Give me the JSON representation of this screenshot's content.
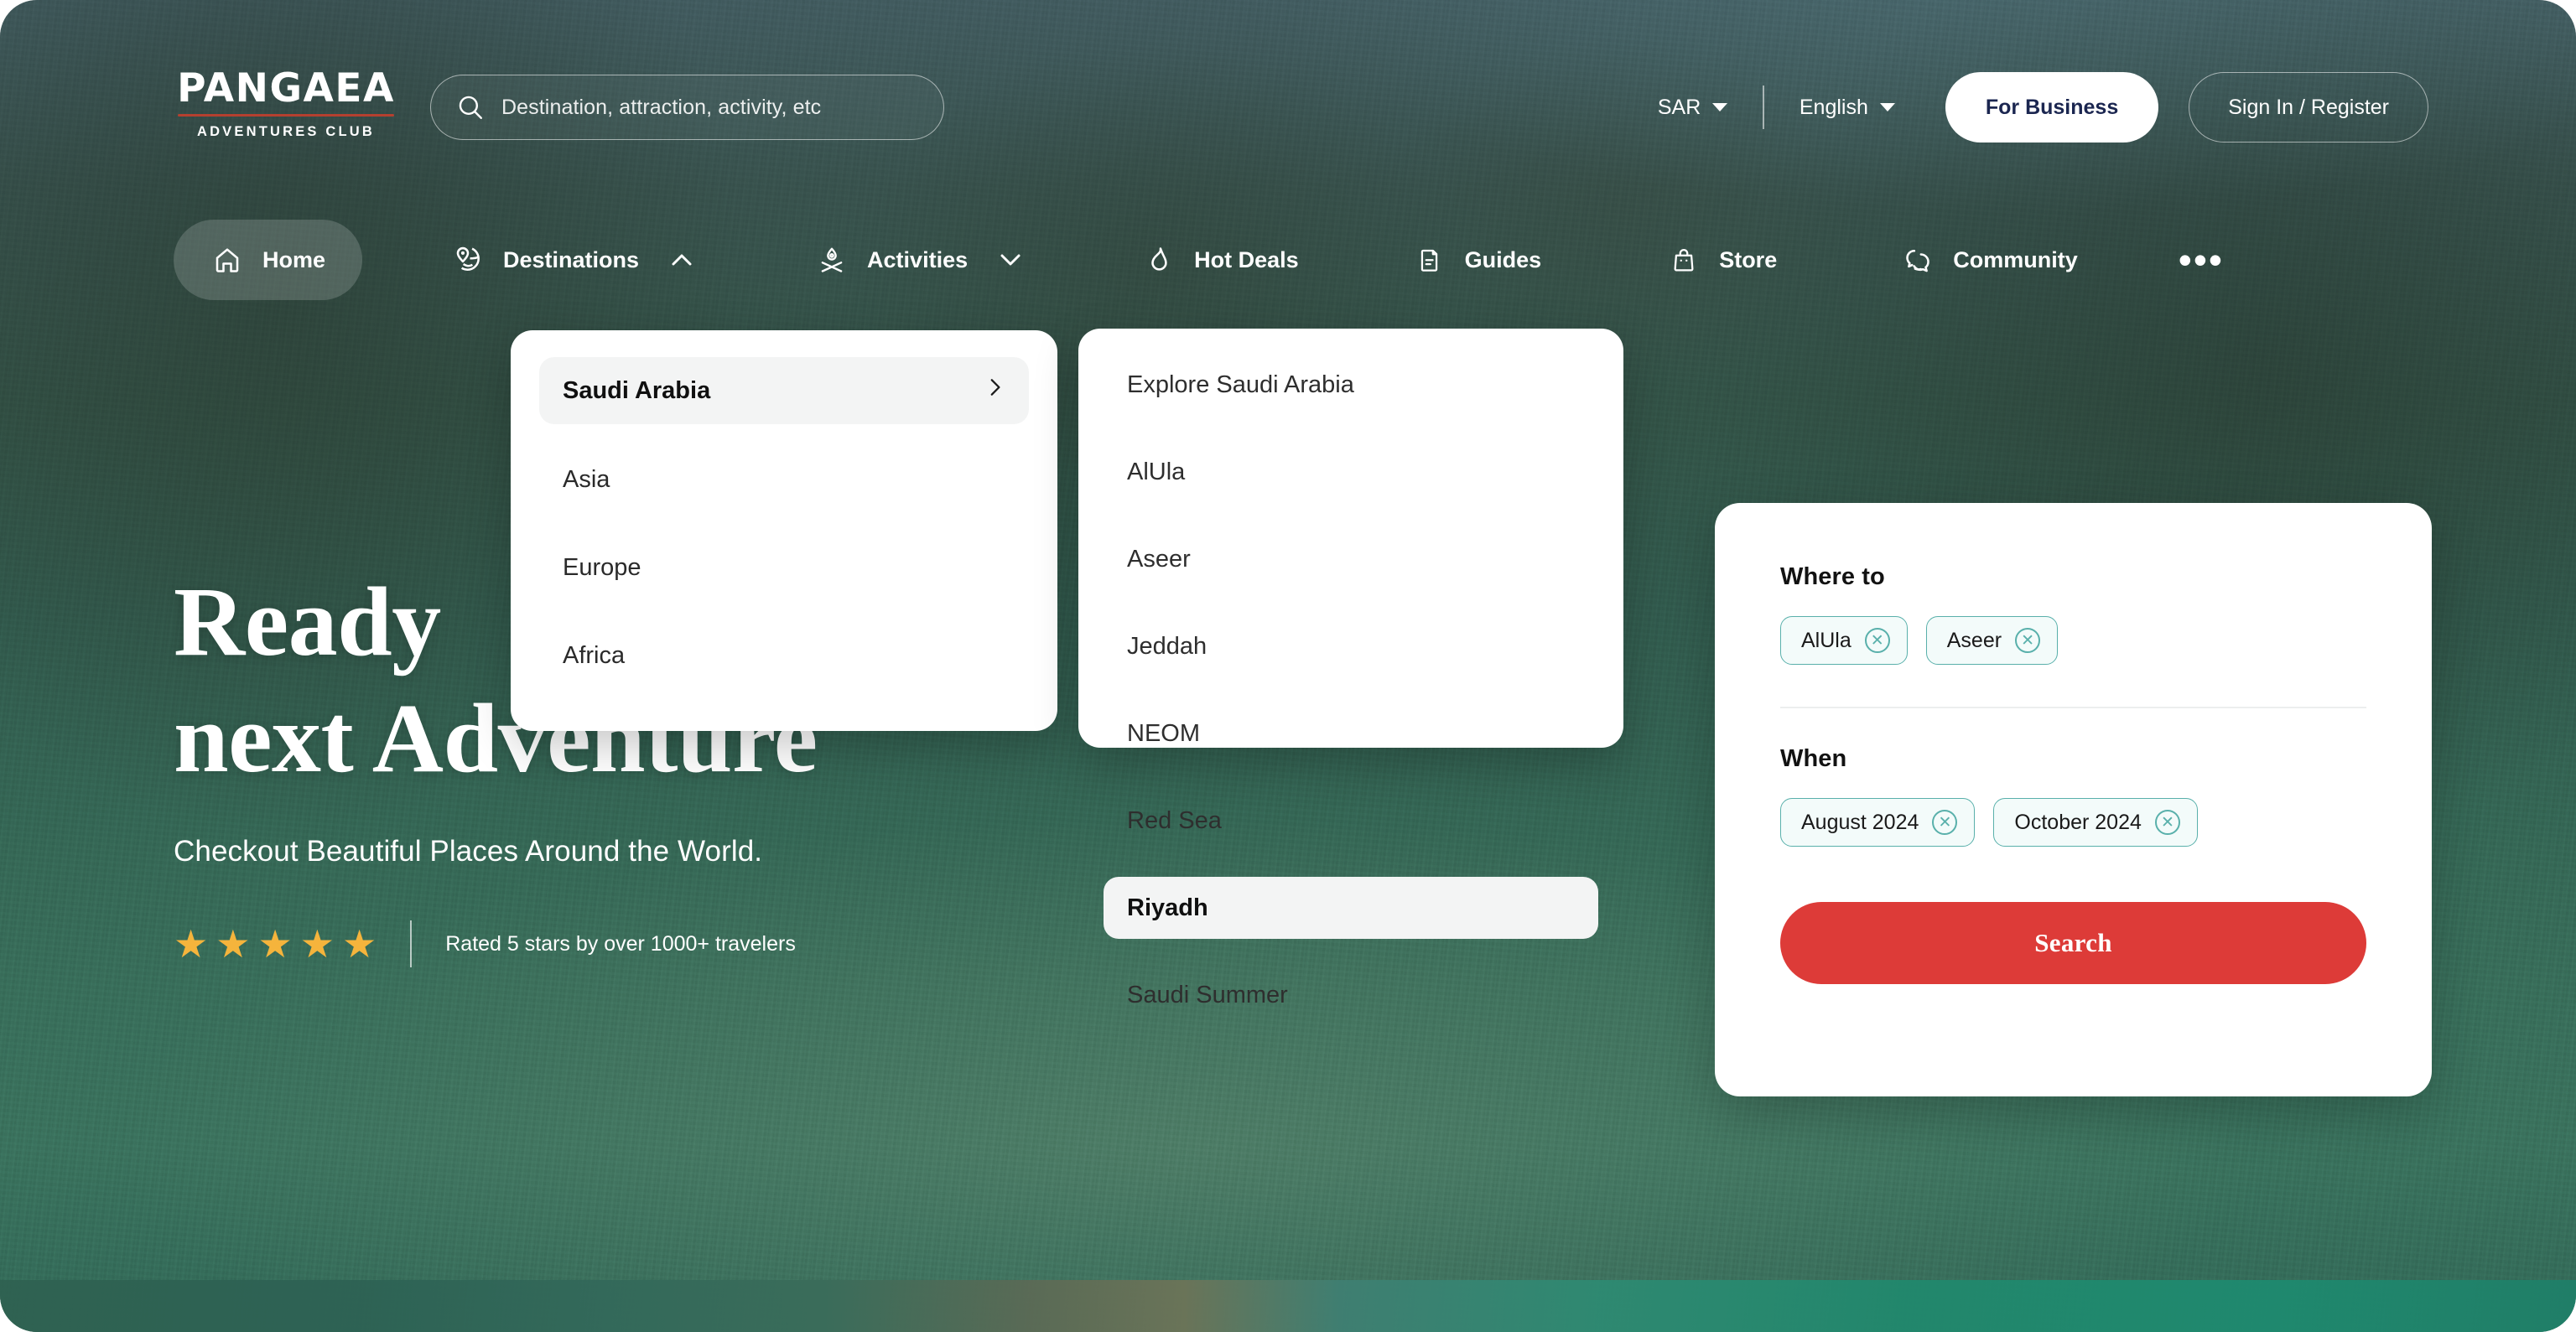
{
  "brand": {
    "name": "PANGAEA",
    "tagline": "ADVENTURES CLUB",
    "rule_color": "#b5402f"
  },
  "search_bar": {
    "placeholder": "Destination, attraction, activity, etc",
    "value": "",
    "icon": "search-icon"
  },
  "header": {
    "currency": "SAR",
    "language": "English",
    "for_business_label": "For Business",
    "sign_in_label": "Sign In / Register"
  },
  "nav": {
    "items": [
      {
        "label": "Home",
        "icon": "home-icon",
        "active": true,
        "caret": ""
      },
      {
        "label": "Destinations",
        "icon": "map-pin-globe-icon",
        "active": false,
        "caret": "chevron-up-icon"
      },
      {
        "label": "Activities",
        "icon": "campfire-icon",
        "active": false,
        "caret": "chevron-down-icon"
      },
      {
        "label": "Hot Deals",
        "icon": "flame-icon",
        "active": false,
        "caret": ""
      },
      {
        "label": "Guides",
        "icon": "guidebook-icon",
        "active": false,
        "caret": ""
      },
      {
        "label": "Store",
        "icon": "shopping-bag-icon",
        "active": false,
        "caret": ""
      },
      {
        "label": "Community",
        "icon": "chat-people-icon",
        "active": false,
        "caret": ""
      }
    ],
    "more_label": "•••"
  },
  "hero": {
    "title_line1": "Ready",
    "title_line2": "next Adventure",
    "subtitle": "Checkout Beautiful Places Around the World.",
    "rating_stars": 5,
    "rating_text": "Rated 5 stars by over 1000+ travelers",
    "star_color": "#f5b43c"
  },
  "regions_menu": {
    "items": [
      {
        "label": "Saudi Arabia",
        "selected": true,
        "chevron": "chevron-right-icon"
      },
      {
        "label": "Asia",
        "selected": false,
        "chevron": ""
      },
      {
        "label": "Europe",
        "selected": false,
        "chevron": ""
      },
      {
        "label": "Africa",
        "selected": false,
        "chevron": ""
      }
    ]
  },
  "destinations_menu": {
    "items": [
      {
        "label": "Explore Saudi Arabia",
        "selected": false
      },
      {
        "label": "AlUla",
        "selected": false
      },
      {
        "label": "Aseer",
        "selected": false
      },
      {
        "label": "Jeddah",
        "selected": false
      },
      {
        "label": "NEOM",
        "selected": false
      },
      {
        "label": "Red Sea",
        "selected": false
      },
      {
        "label": "Riyadh",
        "selected": true
      },
      {
        "label": "Saudi Summer",
        "selected": false
      }
    ]
  },
  "search_panel": {
    "where_label": "Where to",
    "where_chips": [
      "AlUla",
      "Aseer"
    ],
    "when_label": "When",
    "when_chips": [
      "August 2024",
      "October 2024"
    ],
    "submit_label": "Search",
    "chip_border_color": "#59b0ab",
    "submit_color": "#dd3b38",
    "remove_icon": "close-circle-icon"
  }
}
